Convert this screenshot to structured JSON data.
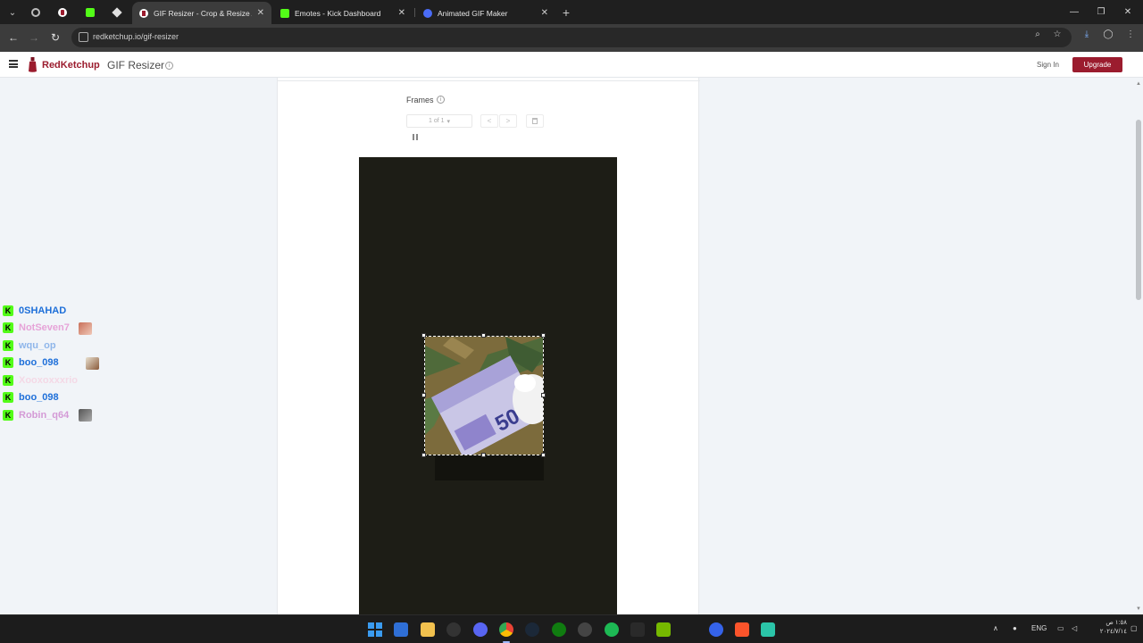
{
  "browser": {
    "tabs": [
      {
        "title": "GIF Resizer - Crop & Resize Ani",
        "active": true,
        "favicon_color": "#9b1c2e"
      },
      {
        "title": "Emotes - Kick Dashboard",
        "active": false,
        "favicon_color": "#53fc18"
      },
      {
        "title": "Animated GIF Maker",
        "active": false,
        "favicon_color": "#4a6cf7"
      }
    ],
    "new_tab_symbol": "+",
    "url": "redketchup.io/gif-resizer"
  },
  "site": {
    "brand": "RedKetchup",
    "tool_name": "GIF Resizer",
    "sign_in": "Sign In",
    "upgrade": "Upgrade"
  },
  "editor": {
    "frames_label": "Frames",
    "frame_select": "1 of 1",
    "prev_symbol": "<",
    "next_symbol": ">"
  },
  "chat": {
    "messages": [
      {
        "user": "0SHAHAD",
        "color": "#1e6fd9",
        "emote": false
      },
      {
        "user": "NotSeven7",
        "color": "#e6a3d8",
        "emote": true
      },
      {
        "user": "wqu_op",
        "color": "#8fb6ea",
        "emote": false
      },
      {
        "user": "boo_098",
        "color": "#1e6fd9",
        "emote": true
      },
      {
        "user": "Xooxoxxxrio",
        "color": "#f4d9e6",
        "emote": false
      },
      {
        "user": "boo_098",
        "color": "#1e6fd9",
        "emote": false
      },
      {
        "user": "Robin_q64",
        "color": "#d49ad6",
        "emote": true
      }
    ]
  },
  "taskbar": {
    "icons": [
      "windows-start",
      "file-explorer-store",
      "files",
      "obs",
      "discord",
      "chrome",
      "steam",
      "xbox",
      "overwolf",
      "spotify",
      "capcut",
      "nvidia",
      "vpn",
      "brave",
      "voice"
    ],
    "language": "ENG",
    "clock_time": "١:٥٨ ص",
    "clock_date": "٢٠٢٤/٧/١٤"
  },
  "colors": {
    "accent": "#9b1c2e",
    "kick_green": "#53fc18"
  }
}
